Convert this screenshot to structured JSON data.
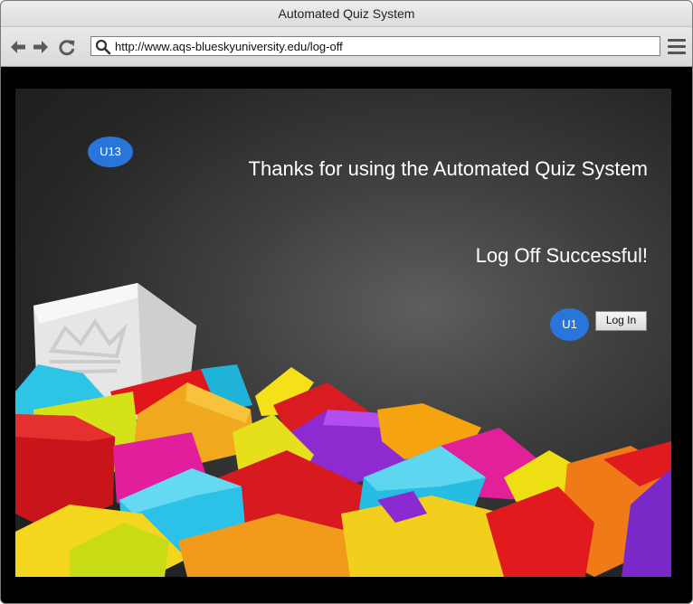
{
  "window": {
    "title": "Automated Quiz System"
  },
  "toolbar": {
    "back_icon": "arrow-left-icon",
    "forward_icon": "arrow-right-icon",
    "reload_icon": "reload-icon",
    "search_icon": "search-icon",
    "url": "http://www.aqs-blueskyuniversity.edu/log-off",
    "menu_icon": "hamburger-menu-icon"
  },
  "page": {
    "headline": "Thanks for using the Automated Quiz System",
    "status": "Log Off Successful!",
    "badge_top": "U13",
    "badge_login": "U1",
    "login_button": "Log In"
  },
  "colors": {
    "badge": "#2a75d9",
    "background_dark": "#1c1c1c",
    "text": "#ffffff"
  }
}
